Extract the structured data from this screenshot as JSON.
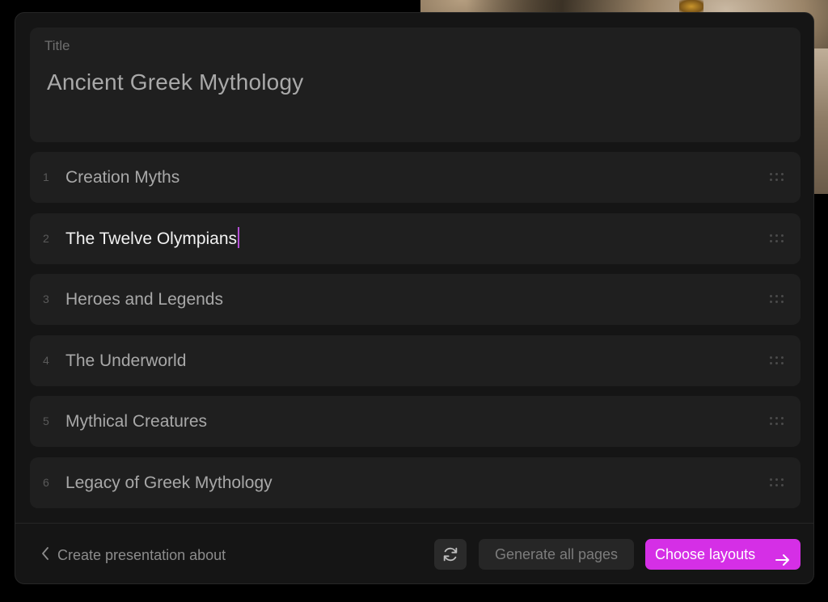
{
  "title_card": {
    "label": "Title",
    "value": "Ancient Greek Mythology"
  },
  "outline": [
    {
      "number": "1",
      "text": "Creation Myths"
    },
    {
      "number": "2",
      "text": "The Twelve Olympians"
    },
    {
      "number": "3",
      "text": "Heroes and Legends"
    },
    {
      "number": "4",
      "text": "The Underworld"
    },
    {
      "number": "5",
      "text": "Mythical Creatures"
    },
    {
      "number": "6",
      "text": "Legacy of Greek Mythology"
    }
  ],
  "footer": {
    "back_label": "Create presentation about",
    "generate_label": "Generate all pages",
    "choose_label": "Choose layouts"
  },
  "icons": {
    "back": "chevron-left-icon",
    "refresh": "refresh-icon",
    "next": "arrow-right-icon",
    "drag": "drag-handle-icon"
  },
  "colors": {
    "accent": "#d52fe6",
    "caret": "#b44fd6",
    "panel": "#151515",
    "card": "#1f1f1f"
  }
}
